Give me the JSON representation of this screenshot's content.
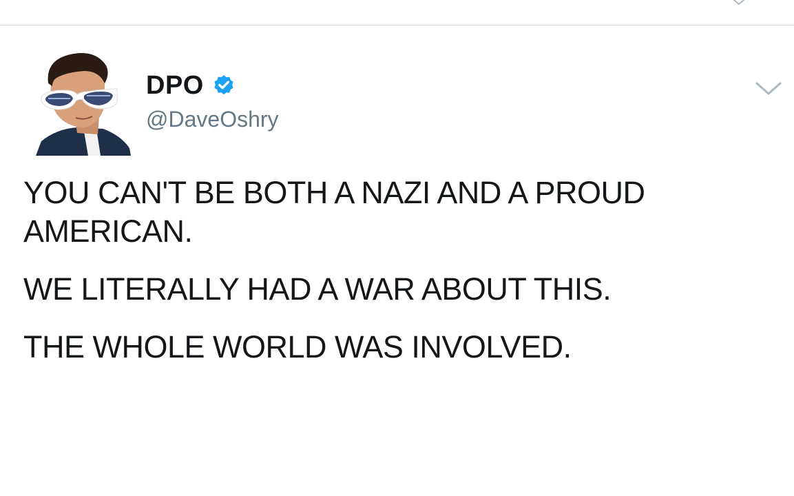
{
  "tweet": {
    "author": {
      "display_name": "DPO",
      "handle": "@DaveOshry",
      "verified": true
    },
    "paragraphs": [
      "YOU CAN'T BE BOTH A NAZI AND A PROUD AMERICAN.",
      "WE LITERALLY HAD A WAR ABOUT THIS.",
      "THE WHOLE WORLD WAS INVOLVED."
    ]
  },
  "icons": {
    "verified": "verified-badge-icon",
    "menu": "chevron-down-icon"
  },
  "colors": {
    "text": "#14171a",
    "secondary_text": "#657786",
    "verified_blue": "#1da1f2",
    "divider": "#d6dadd",
    "caret": "#aab8c2"
  }
}
